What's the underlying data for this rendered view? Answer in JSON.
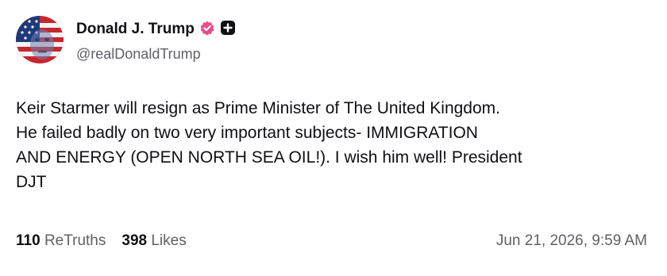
{
  "author": {
    "display_name": "Donald J. Trump",
    "handle": "@realDonaldTrump",
    "verified_icon": "verified-badge-icon",
    "verified_color": "#e84c8a",
    "extra_icon": "plus-square-icon"
  },
  "post": {
    "lines": [
      "Keir Starmer will resign as Prime Minister of The United Kingdom.",
      "He failed badly on two very important subjects- IMMIGRATION",
      "AND ENERGY (OPEN NORTH SEA OIL!). I wish him well! President",
      "DJT"
    ]
  },
  "stats": {
    "retruths_count": "110",
    "retruths_label": "ReTruths",
    "likes_count": "398",
    "likes_label": "Likes"
  },
  "timestamp": "Jun 21, 2026, 9:59 AM"
}
